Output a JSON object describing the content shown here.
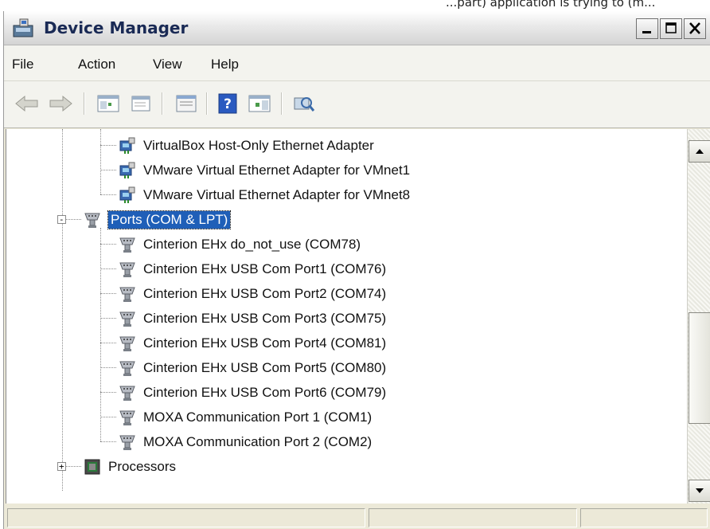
{
  "window": {
    "title": "Device Manager"
  },
  "background_text": "...part) application is trying to (m...",
  "menu": [
    "File",
    "Action",
    "View",
    "Help"
  ],
  "toolbar": {
    "icons": [
      "back-arrow-icon",
      "forward-arrow-icon",
      "show-hide-console-tree-icon",
      "properties-icon",
      "help-icon",
      "action-pane-icon",
      "scan-hardware-icon"
    ]
  },
  "tree": {
    "network_children": [
      "VirtualBox Host-Only Ethernet Adapter",
      "VMware Virtual Ethernet Adapter for VMnet1",
      "VMware Virtual Ethernet Adapter for VMnet8"
    ],
    "ports": {
      "label": "Ports (COM & LPT)",
      "expanded": true,
      "selected": true,
      "children": [
        "Cinterion EHx do_not_use (COM78)",
        "Cinterion EHx USB Com Port1 (COM76)",
        "Cinterion EHx USB Com Port2 (COM74)",
        "Cinterion EHx USB Com Port3 (COM75)",
        "Cinterion EHx USB Com Port4 (COM81)",
        "Cinterion EHx USB Com Port5 (COM80)",
        "Cinterion EHx USB Com Port6 (COM79)",
        "MOXA Communication Port 1 (COM1)",
        "MOXA Communication Port 2 (COM2)"
      ]
    },
    "processors": {
      "label": "Processors",
      "expanded": false
    }
  },
  "colors": {
    "selection": "#1f5fb8",
    "window_bg": "#ece9d8"
  }
}
